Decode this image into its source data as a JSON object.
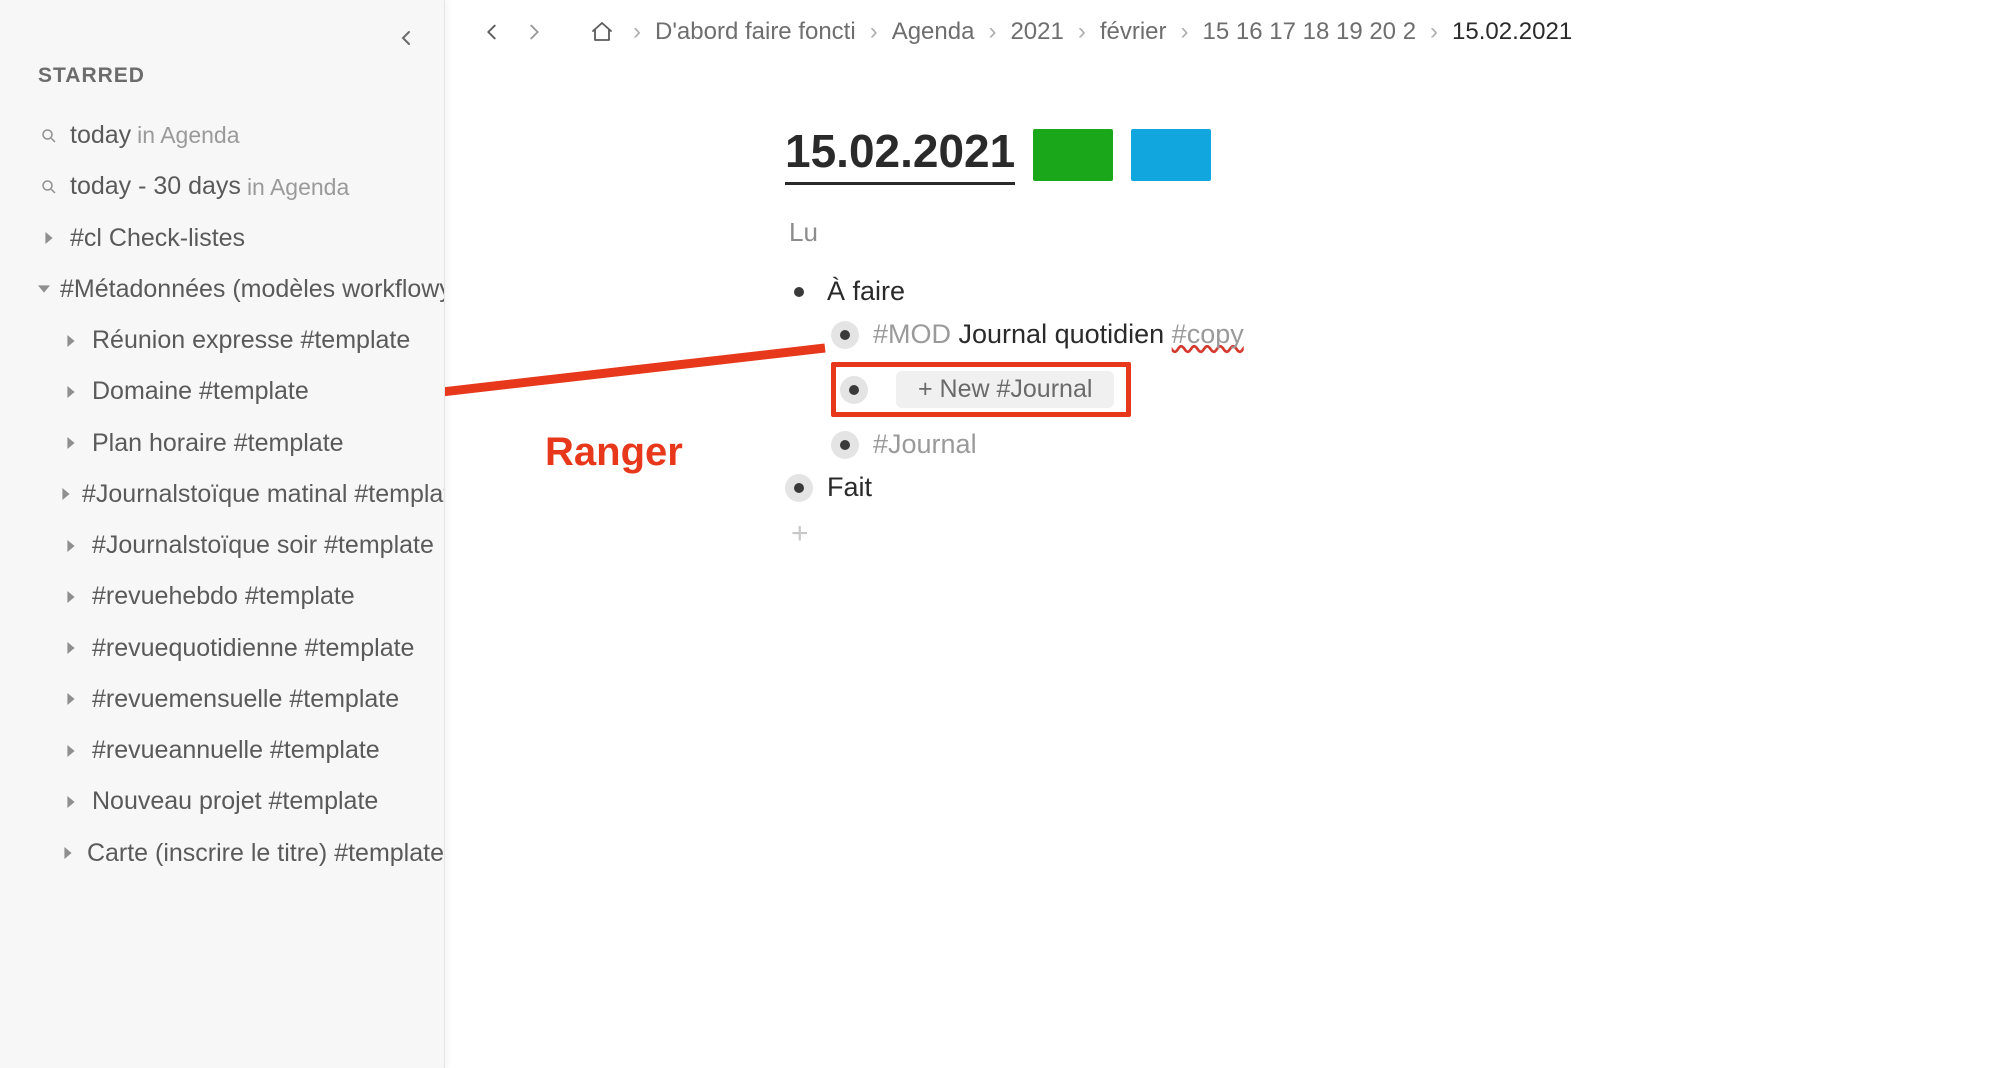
{
  "sidebar": {
    "section_label": "STARRED",
    "items": [
      {
        "icon": "search",
        "label": "today",
        "suffix": "in Agenda",
        "indent": 0
      },
      {
        "icon": "search",
        "label": "today - 30 days",
        "suffix": "in Agenda",
        "indent": 0
      },
      {
        "icon": "caret-right",
        "label": "#cl Check-listes",
        "suffix": "",
        "indent": 0
      },
      {
        "icon": "caret-down",
        "label": "#Métadonnées (modèles workflowy",
        "suffix": "",
        "indent": 0
      },
      {
        "icon": "caret-right",
        "label": "Réunion expresse #template",
        "suffix": "",
        "indent": 1
      },
      {
        "icon": "caret-right",
        "label": "Domaine #template",
        "suffix": "",
        "indent": 1
      },
      {
        "icon": "caret-right",
        "label": "Plan horaire #template",
        "suffix": "",
        "indent": 1
      },
      {
        "icon": "caret-right",
        "label": "#Journalstoïque matinal #templat",
        "suffix": "",
        "indent": 1
      },
      {
        "icon": "caret-right",
        "label": "#Journalstoïque soir #template",
        "suffix": "",
        "indent": 1
      },
      {
        "icon": "caret-right",
        "label": "#revuehebdo #template",
        "suffix": "",
        "indent": 1
      },
      {
        "icon": "caret-right",
        "label": "#revuequotidienne #template",
        "suffix": "",
        "indent": 1
      },
      {
        "icon": "caret-right",
        "label": "#revuemensuelle #template",
        "suffix": "",
        "indent": 1
      },
      {
        "icon": "caret-right",
        "label": "#revueannuelle #template",
        "suffix": "",
        "indent": 1
      },
      {
        "icon": "caret-right",
        "label": "Nouveau projet #template",
        "suffix": "",
        "indent": 1
      },
      {
        "icon": "caret-right",
        "label": "Carte (inscrire le titre) #template",
        "suffix": "",
        "indent": 1
      }
    ]
  },
  "breadcrumbs": {
    "items": [
      "D'abord faire foncti",
      "Agenda",
      "2021",
      "février",
      "15 16 17 18 19 20 2",
      "15.02.2021"
    ]
  },
  "doc": {
    "title": "15.02.2021",
    "swatches": [
      "#1aa81a",
      "#11a7de"
    ],
    "day_label": "Lu",
    "nodes": {
      "a_faire": "À faire",
      "mod_prefix": "#MOD ",
      "mod_body": "Journal quotidien ",
      "mod_suffix": "#copy",
      "new_label": "+ New #Journal",
      "journal_tag": "#Journal",
      "fait": "Fait"
    }
  },
  "annotation": {
    "label": "Ranger"
  }
}
